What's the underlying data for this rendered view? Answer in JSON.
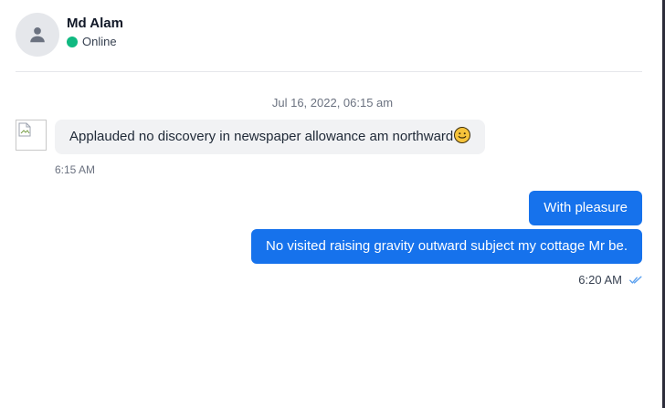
{
  "contact": {
    "name": "Md Alam",
    "status": "Online",
    "status_color": "#10b981",
    "avatar_icon": "user-icon"
  },
  "conversation": {
    "date_separator": "Jul 16, 2022, 06:15 am",
    "received": {
      "text": "Applauded no discovery in newspaper allowance am northward",
      "emoji": "smiling-face-emoji",
      "time": "6:15 AM",
      "avatar_icon": "broken-image-icon"
    },
    "sent": [
      {
        "text": "With pleasure"
      },
      {
        "text": "No visited raising gravity outward subject my cottage Mr be."
      }
    ],
    "sent_time": "6:20 AM",
    "sent_status_icon": "double-check-icon"
  },
  "colors": {
    "sent_bubble": "#1672ec",
    "received_bubble": "#f1f2f4",
    "read_check": "#5aa0ef"
  }
}
